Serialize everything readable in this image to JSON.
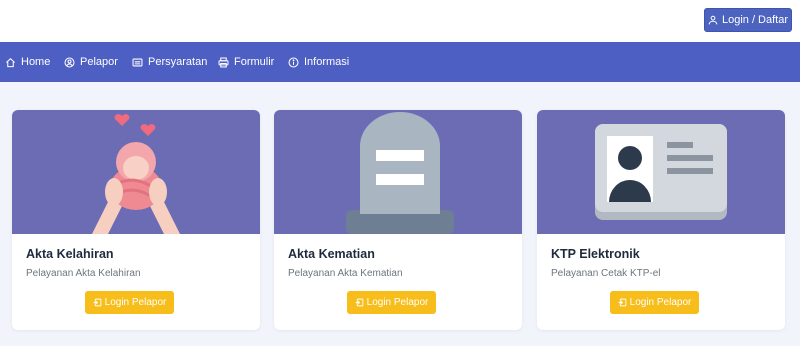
{
  "header": {
    "login_label": "Login / Daftar",
    "login_icon": "user-icon"
  },
  "nav": {
    "items": [
      {
        "label": "Home",
        "icon": "home-icon"
      },
      {
        "label": "Pelapor",
        "icon": "user-circle-icon"
      },
      {
        "label": "Persyaratan",
        "icon": "id-card-icon"
      },
      {
        "label": "Formulir",
        "icon": "printer-icon"
      },
      {
        "label": "Informasi",
        "icon": "info-icon"
      }
    ]
  },
  "cards": [
    {
      "title": "Akta Kelahiran",
      "subtitle": "Pelayanan Akta Kelahiran",
      "button": "Login Pelapor",
      "illustration": "baby-in-hands-illustration"
    },
    {
      "title": "Akta Kematian",
      "subtitle": "Pelayanan Akta Kematian",
      "button": "Login Pelapor",
      "illustration": "gravestone-illustration"
    },
    {
      "title": "KTP Elektronik",
      "subtitle": "Pelayanan Cetak KTP-el",
      "button": "Login Pelapor",
      "illustration": "id-card-illustration"
    }
  ],
  "colors": {
    "navbar": "#4e5fc4",
    "accent_button": "#f7bd1a",
    "login_button": "#4c63c0",
    "illustration_bg": "#6c6cb4",
    "page_bg": "#f1f5fb"
  }
}
